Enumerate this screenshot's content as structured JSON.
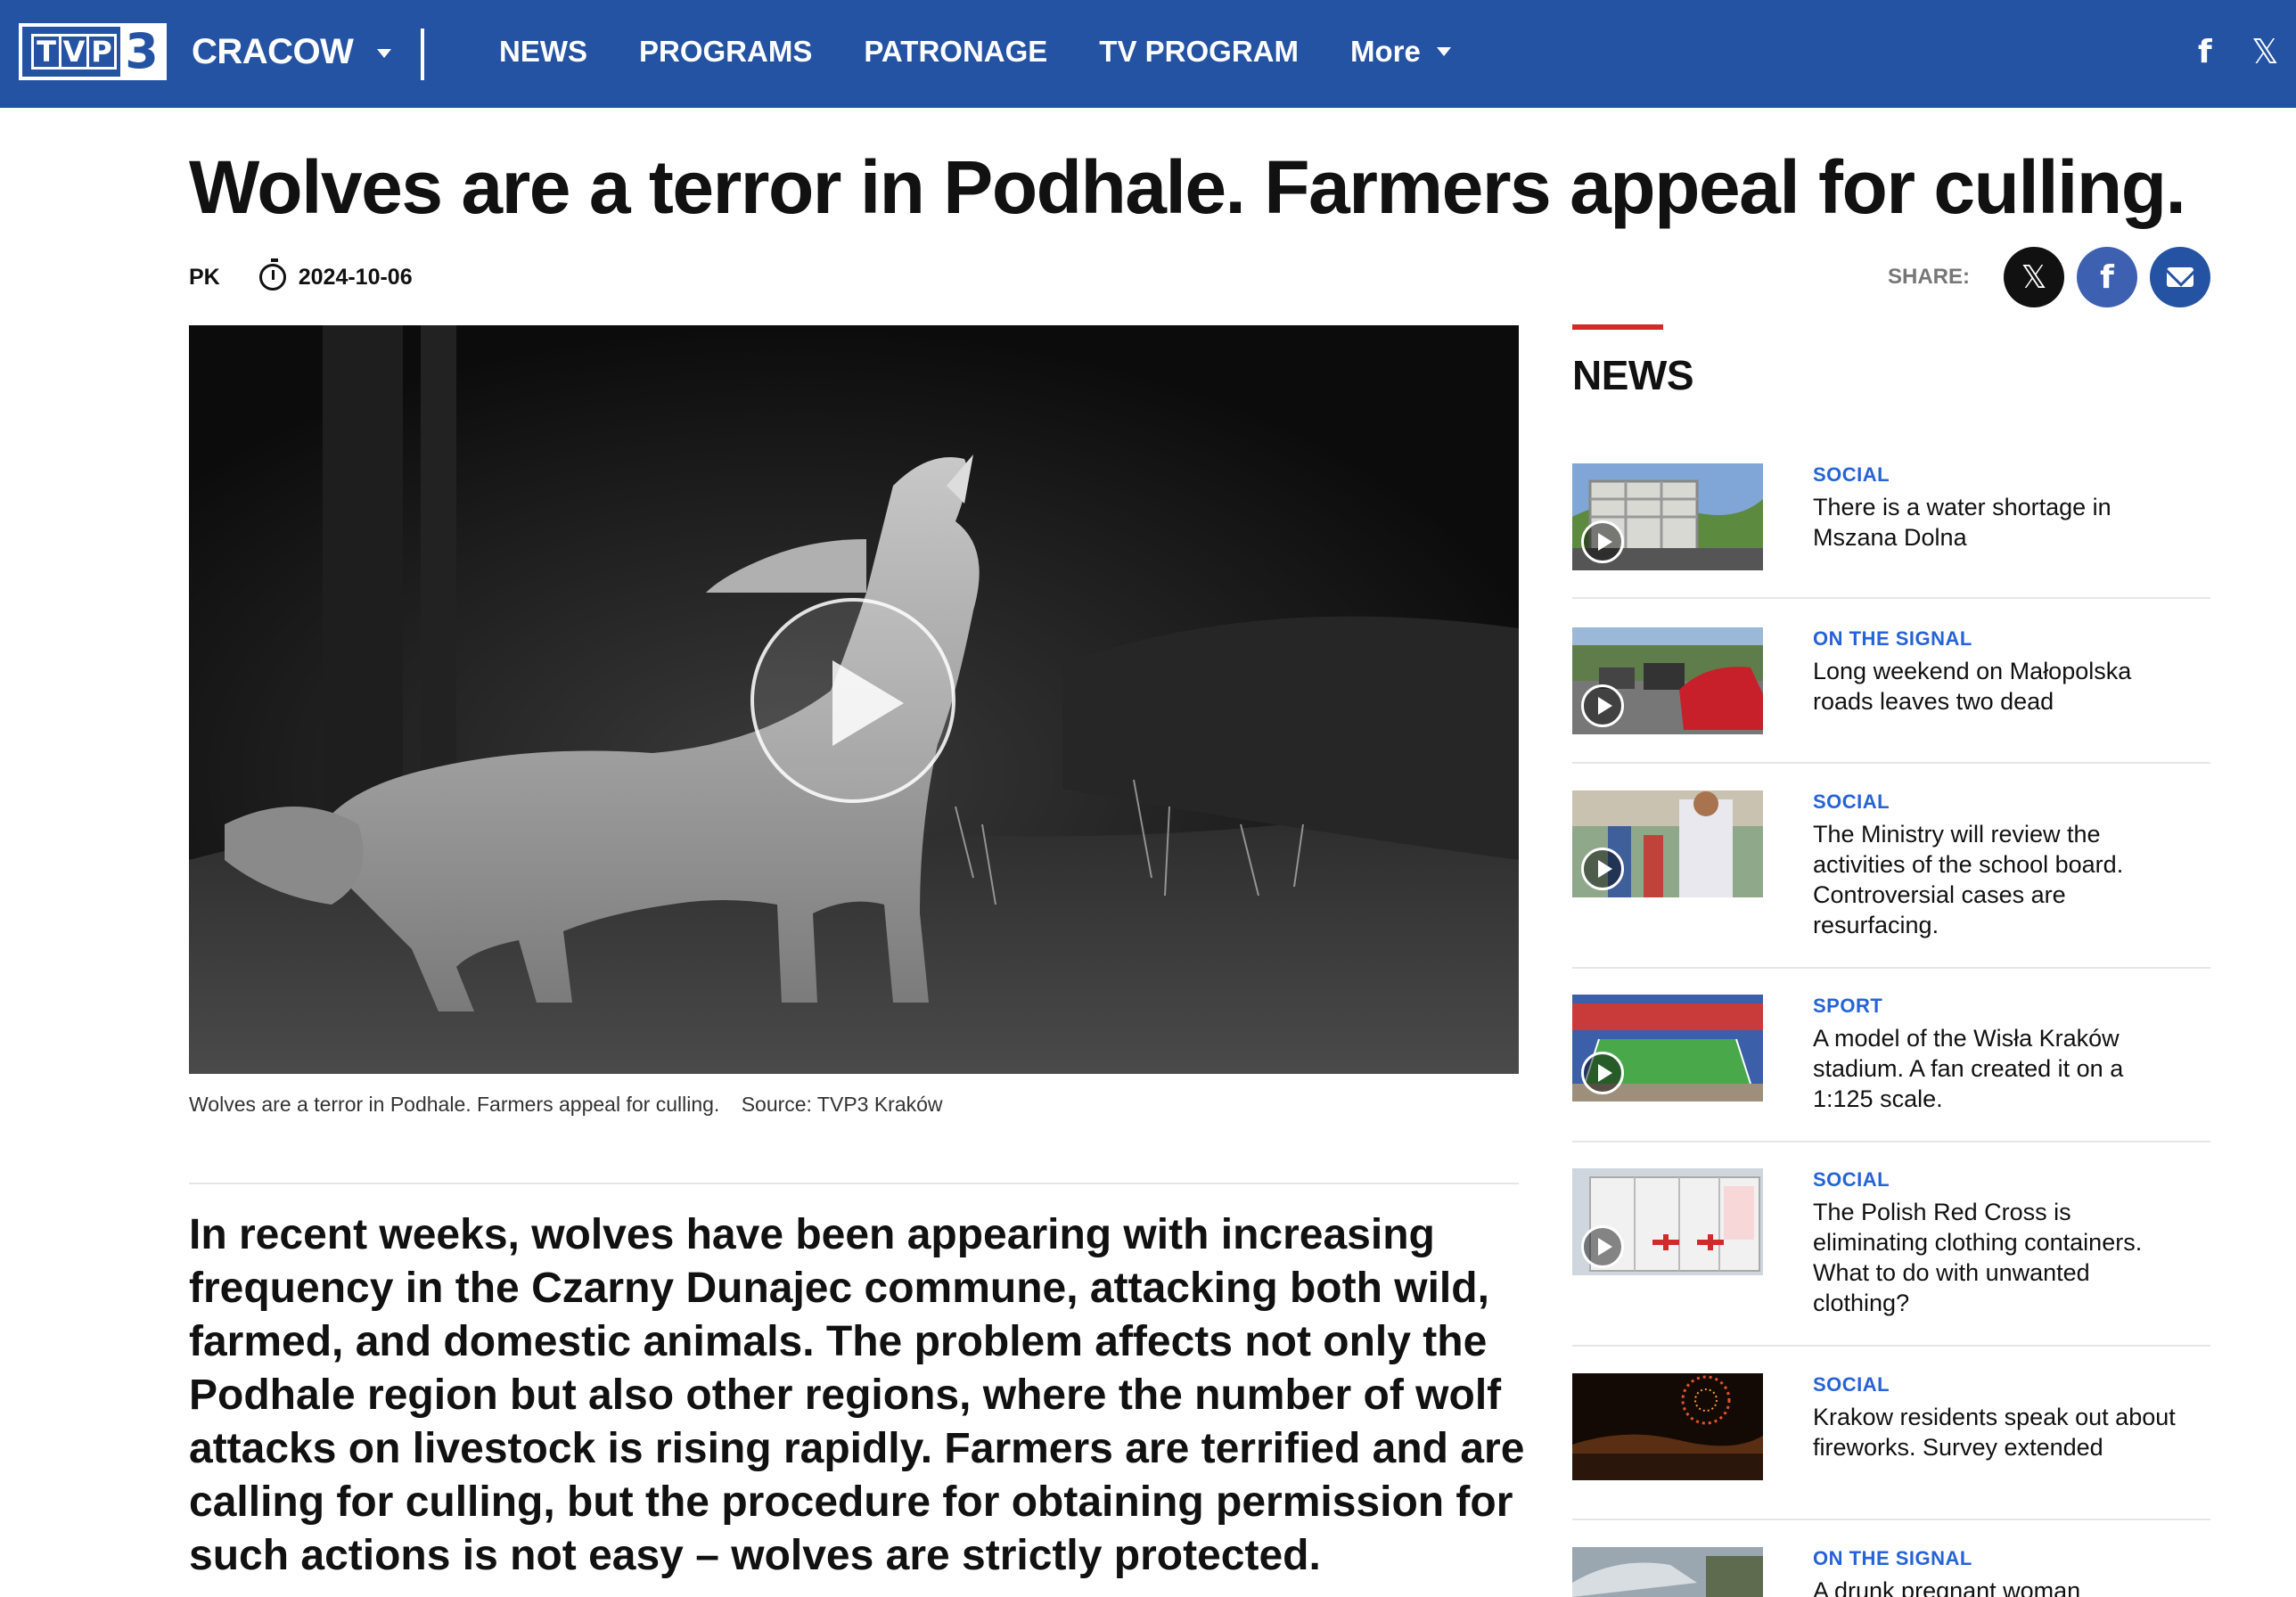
{
  "nav": {
    "logo_text": "TVP3",
    "logo_letters": [
      "T",
      "V",
      "P"
    ],
    "logo_number": "3",
    "city": "CRACOW",
    "links": [
      "NEWS",
      "PROGRAMS",
      "PATRONAGE",
      "TV PROGRAM"
    ],
    "more": "More",
    "social": {
      "facebook": "f",
      "x": "𝕏"
    }
  },
  "article": {
    "headline": "Wolves are a terror in Podhale. Farmers appeal for culling.",
    "author": "PK",
    "date": "2024-10-06",
    "share_label": "SHARE:",
    "share_x": "𝕏",
    "share_fb": "f",
    "caption": "Wolves are a terror in Podhale. Farmers appeal for culling.",
    "source": "Source: TVP3 Kraków",
    "lead": "In recent weeks, wolves have been appearing with increasing frequency in the Czarny Dunajec commune, attacking both wild, farmed, and domestic animals. The problem affects not only the Podhale region but also other regions, where the number of wolf attacks on livestock is rising rapidly. Farmers are terrified and are calling for culling, but the procedure for obtaining permission for such actions is not easy – wolves are strictly protected."
  },
  "sidebar": {
    "title": "NEWS",
    "items": [
      {
        "category": "SOCIAL",
        "title": "There is a water shortage in Mszana Dolna",
        "video": true
      },
      {
        "category": "ON THE SIGNAL",
        "title": "Long weekend on Małopolska roads leaves two dead",
        "video": true
      },
      {
        "category": "SOCIAL",
        "title": "The Ministry will review the activities of the school board. Controversial cases are resurfacing.",
        "video": true
      },
      {
        "category": "SPORT",
        "title": "A model of the Wisła Kraków stadium. A fan created it on a 1:125 scale.",
        "video": true
      },
      {
        "category": "SOCIAL",
        "title": "The Polish Red Cross is eliminating clothing containers. What to do with unwanted clothing?",
        "video": true
      },
      {
        "category": "SOCIAL",
        "title": "Krakow residents speak out about fireworks. Survey extended",
        "video": false
      },
      {
        "category": "ON THE SIGNAL",
        "title": "A drunk pregnant woman",
        "video": false
      }
    ]
  },
  "colors": {
    "nav_bg": "#2553a3",
    "category": "#2563d6",
    "accent": "#d62828"
  }
}
